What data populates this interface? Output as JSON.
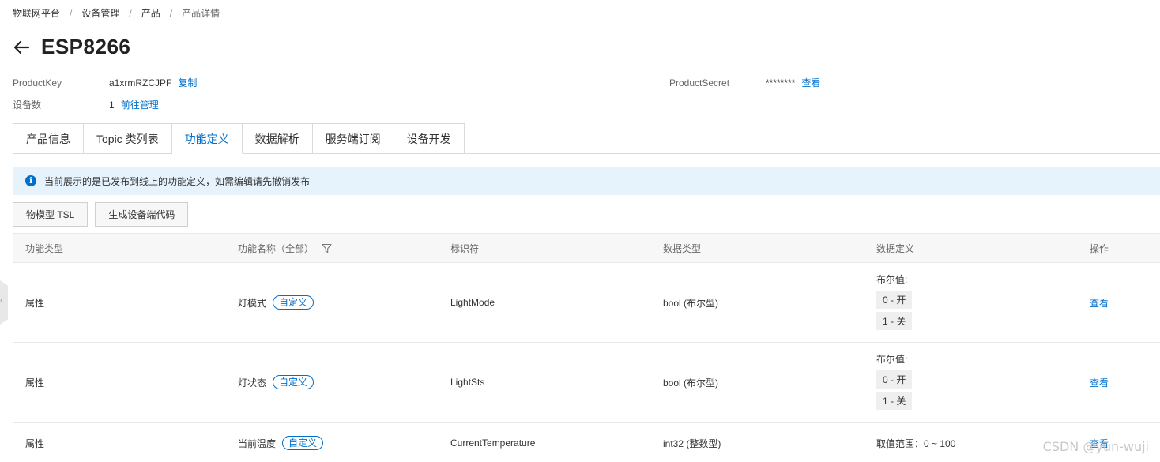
{
  "breadcrumb": {
    "items": [
      "物联网平台",
      "设备管理",
      "产品",
      "产品详情"
    ],
    "separator": "/"
  },
  "header": {
    "title": "ESP8266"
  },
  "meta": {
    "product_key_label": "ProductKey",
    "product_key_value": "a1xrmRZCJPF",
    "copy_label": "复制",
    "device_count_label": "设备数",
    "device_count_value": "1",
    "manage_label": "前往管理",
    "product_secret_label": "ProductSecret",
    "product_secret_value": "********",
    "view_label": "查看"
  },
  "tabs": [
    {
      "label": "产品信息",
      "active": false
    },
    {
      "label": "Topic 类列表",
      "active": false
    },
    {
      "label": "功能定义",
      "active": true
    },
    {
      "label": "数据解析",
      "active": false
    },
    {
      "label": "服务端订阅",
      "active": false
    },
    {
      "label": "设备开发",
      "active": false
    }
  ],
  "alert": {
    "icon": "info-icon",
    "text": "当前展示的是已发布到线上的功能定义，如需编辑请先撤销发布"
  },
  "buttons": {
    "tsl_label": "物模型 TSL",
    "gen_code_label": "生成设备端代码"
  },
  "table": {
    "headers": [
      "功能类型",
      "功能名称（全部）",
      "标识符",
      "数据类型",
      "数据定义",
      "操作"
    ],
    "rows": [
      {
        "type": "属性",
        "name": "灯模式",
        "tag": "自定义",
        "identifier": "LightMode",
        "data_type": "bool (布尔型)",
        "def_title": "布尔值:",
        "def_items": [
          "0 - 开",
          "1 - 关"
        ],
        "action": "查看"
      },
      {
        "type": "属性",
        "name": "灯状态",
        "tag": "自定义",
        "identifier": "LightSts",
        "data_type": "bool (布尔型)",
        "def_title": "布尔值:",
        "def_items": [
          "0 - 开",
          "1 - 关"
        ],
        "action": "查看"
      },
      {
        "type": "属性",
        "name": "当前温度",
        "tag": "自定义",
        "identifier": "CurrentTemperature",
        "data_type": "int32 (整数型)",
        "def_title": "取值范围：0 ~ 100",
        "def_items": [],
        "action": "查看"
      }
    ]
  },
  "watermark": "CSDN @yun-wuji",
  "colors": {
    "accent": "#0070cc",
    "alert_bg": "#e6f3fd",
    "header_bg": "#f7f7f7",
    "chip_bg": "#efefef"
  }
}
